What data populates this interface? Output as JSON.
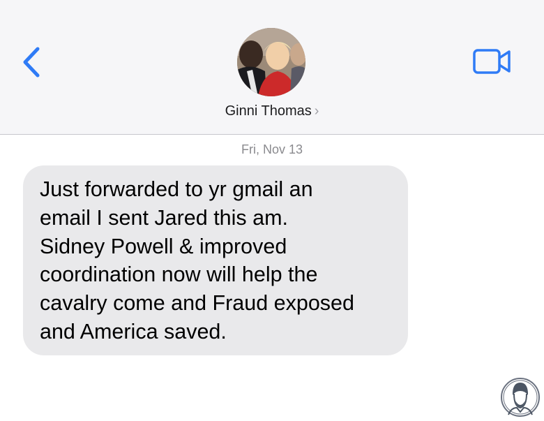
{
  "header": {
    "contact_name": "Ginni Thomas",
    "back_icon": "chevron-left-icon",
    "video_icon": "video-camera-icon",
    "accent_color": "#2f7bf6"
  },
  "conversation": {
    "date_label": "Fri, Nov 13",
    "messages": [
      {
        "direction": "incoming",
        "lines": [
          "Just forwarded to yr gmail an",
          "email I sent Jared this am.",
          "Sidney Powell & improved",
          "coordination now will help the",
          "cavalry come and Fraud exposed",
          "and America saved."
        ]
      }
    ]
  }
}
